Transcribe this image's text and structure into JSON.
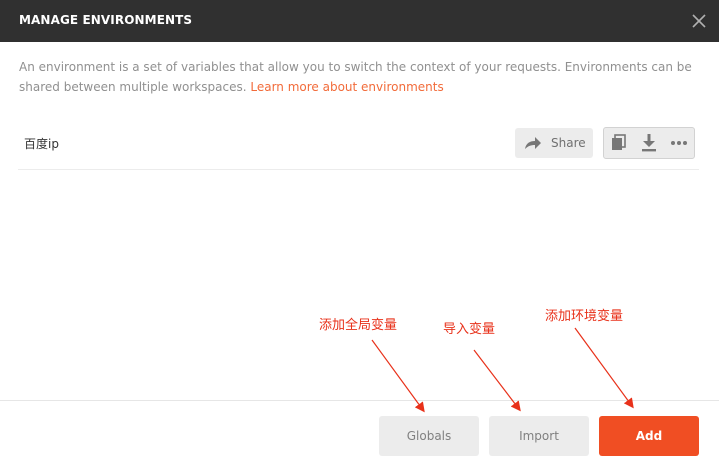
{
  "modal": {
    "title": "MANAGE ENVIRONMENTS",
    "close_icon": "close-icon"
  },
  "description": {
    "text": "An environment is a set of variables that allow you to switch the context of your requests. Environments can be shared between multiple workspaces.",
    "link_text": "Learn more about environments"
  },
  "environments": [
    {
      "name": "百度ip",
      "share_label": "Share",
      "share_icon": "share-arrow-icon",
      "action_icons": [
        "duplicate-icon",
        "download-icon",
        "more-icon"
      ]
    }
  ],
  "footer": {
    "globals_label": "Globals",
    "import_label": "Import",
    "add_label": "Add"
  },
  "annotations": {
    "globals": "添加全局变量",
    "import": "导入变量",
    "add": "添加环境变量"
  },
  "colors": {
    "titlebar": "#303030",
    "accent": "#f04e23",
    "link": "#f26b3a",
    "annotation": "#e8311a"
  }
}
